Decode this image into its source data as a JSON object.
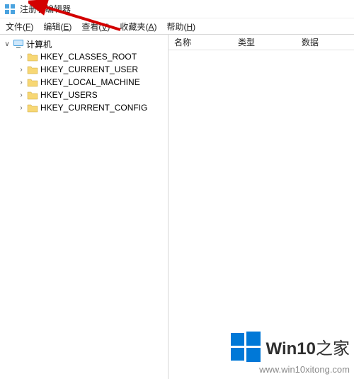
{
  "window": {
    "title": "注册表编辑器"
  },
  "menu": {
    "file": {
      "label": "文件",
      "hotkey": "F"
    },
    "edit": {
      "label": "编辑",
      "hotkey": "E"
    },
    "view": {
      "label": "查看",
      "hotkey": "V"
    },
    "fav": {
      "label": "收藏夹",
      "hotkey": "A"
    },
    "help": {
      "label": "帮助",
      "hotkey": "H"
    }
  },
  "tree": {
    "root_label": "计算机",
    "children": [
      {
        "label": "HKEY_CLASSES_ROOT"
      },
      {
        "label": "HKEY_CURRENT_USER"
      },
      {
        "label": "HKEY_LOCAL_MACHINE"
      },
      {
        "label": "HKEY_USERS"
      },
      {
        "label": "HKEY_CURRENT_CONFIG"
      }
    ]
  },
  "list": {
    "headers": {
      "name": "名称",
      "type": "类型",
      "data": "数据"
    }
  },
  "watermark": {
    "text_a": "Win10",
    "text_b": "之家",
    "url": "www.win10xitong.com",
    "accent": "#0078d7"
  }
}
